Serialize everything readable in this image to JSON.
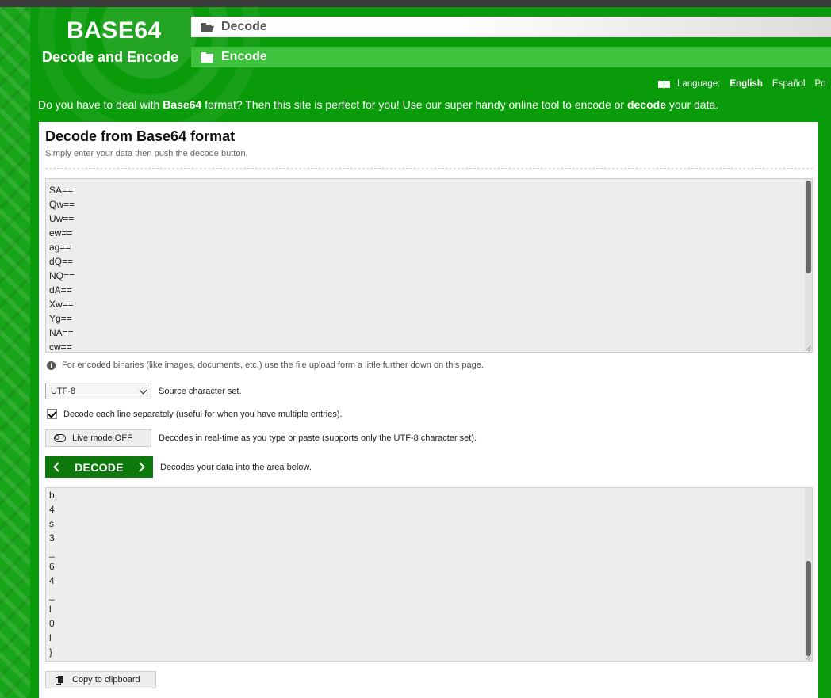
{
  "header": {
    "logo_title": "BASE64",
    "logo_subtitle": "Decode and Encode",
    "nav": [
      {
        "label": "Decode",
        "icon": "folder-open-icon"
      },
      {
        "label": "Encode",
        "icon": "folder-icon"
      }
    ]
  },
  "language_bar": {
    "label": "Language:",
    "options": [
      "English",
      "Español",
      "Po"
    ],
    "selected": "English"
  },
  "intro": {
    "part1": "Do you have to deal with ",
    "bold1": "Base64",
    "part2": " format? Then this site is perfect for you! Use our super handy online tool to encode or ",
    "bold2": "decode",
    "part3": " your data."
  },
  "panel": {
    "title": "Decode from Base64 format",
    "subtitle": "Simply enter your data then push the decode button.",
    "input_lines": [
      "SA==",
      "Qw==",
      "Uw==",
      "ew==",
      "ag==",
      "dQ==",
      "NQ==",
      "dA==",
      "Xw==",
      "Yg==",
      "NA==",
      "cw=="
    ],
    "info_text": "For encoded binaries (like images, documents, etc.) use the file upload form a little further down on this page.",
    "charset_value": "UTF-8",
    "charset_label": "Source character set.",
    "decode_lines_checked": true,
    "decode_lines_label": "Decode each line separately (useful for when you have multiple entries).",
    "live_mode_label": "Live mode OFF",
    "live_mode_desc": "Decodes in real-time as you type or paste (supports only the UTF-8 character set).",
    "decode_button": "DECODE",
    "decode_desc": "Decodes your data into the area below.",
    "output_lines": [
      "b",
      "4",
      "s",
      "3",
      "_",
      "6",
      "4",
      "_",
      "l",
      "0",
      "l",
      "}"
    ],
    "copy_button": "Copy to clipboard"
  },
  "colors": {
    "background": "#0a9b0a",
    "decode_button": "#0e7a0e",
    "encode_tab": "#3ec23e"
  }
}
